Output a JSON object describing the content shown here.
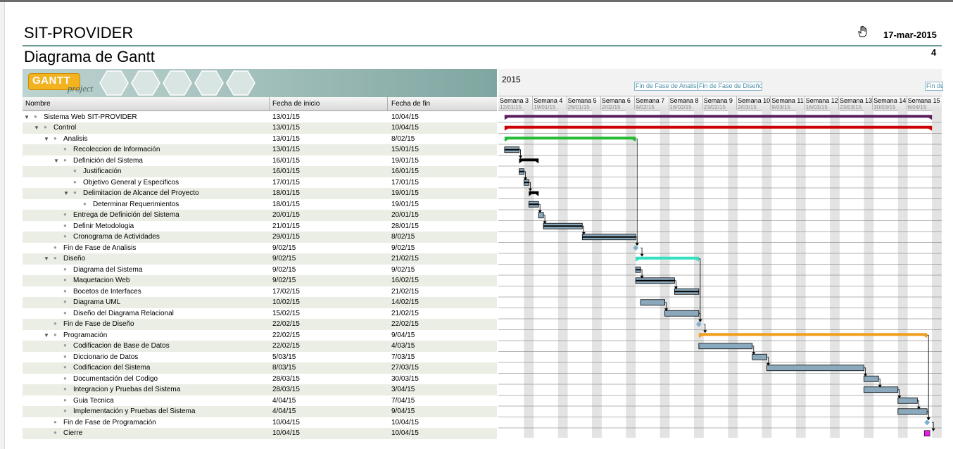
{
  "header": {
    "project_title": "SIT-PROVIDER",
    "document_title": "Diagrama de Gantt",
    "date": "17-mar-2015",
    "page_number": "4"
  },
  "logo": {
    "main": "GANTT",
    "sub": "project"
  },
  "columns": {
    "name": "Nombre",
    "start": "Fecha de inicio",
    "end": "Fecha de fin"
  },
  "tasks": [
    {
      "name": "Sistema Web SIT-PROVIDER",
      "start": "13/01/15",
      "end": "10/04/15",
      "level": 0,
      "expanded": true
    },
    {
      "name": "Control",
      "start": "13/01/15",
      "end": "10/04/15",
      "level": 1,
      "expanded": true
    },
    {
      "name": "Analisis",
      "start": "13/01/15",
      "end": "8/02/15",
      "level": 2,
      "expanded": true
    },
    {
      "name": "Recoleccion de Información",
      "start": "13/01/15",
      "end": "15/01/15",
      "level": 3
    },
    {
      "name": "Definición del Sistema",
      "start": "16/01/15",
      "end": "19/01/15",
      "level": 3,
      "expanded": true
    },
    {
      "name": "Justificación",
      "start": "16/01/15",
      "end": "16/01/15",
      "level": 4
    },
    {
      "name": "Objetivo General y Especificos",
      "start": "17/01/15",
      "end": "17/01/15",
      "level": 4
    },
    {
      "name": "Delimitacion de Alcance del Proyecto",
      "start": "18/01/15",
      "end": "19/01/15",
      "level": 4,
      "expanded": true
    },
    {
      "name": "Determinar Requerimientos",
      "start": "18/01/15",
      "end": "19/01/15",
      "level": 5
    },
    {
      "name": "Entrega de Definición del Sistema",
      "start": "20/01/15",
      "end": "20/01/15",
      "level": 3
    },
    {
      "name": "Definir Metodologia",
      "start": "21/01/15",
      "end": "28/01/15",
      "level": 3
    },
    {
      "name": "Cronograma de Actividades",
      "start": "29/01/15",
      "end": "8/02/15",
      "level": 3
    },
    {
      "name": "Fin de Fase de Analisis",
      "start": "9/02/15",
      "end": "9/02/15",
      "level": 2
    },
    {
      "name": "Diseño",
      "start": "9/02/15",
      "end": "21/02/15",
      "level": 2,
      "expanded": true
    },
    {
      "name": "Diagrama del Sistema",
      "start": "9/02/15",
      "end": "9/02/15",
      "level": 3
    },
    {
      "name": "Maquetacion Web",
      "start": "9/02/15",
      "end": "16/02/15",
      "level": 3
    },
    {
      "name": "Bocetos de Interfaces",
      "start": "17/02/15",
      "end": "21/02/15",
      "level": 3
    },
    {
      "name": "Diagrama UML",
      "start": "10/02/15",
      "end": "14/02/15",
      "level": 3
    },
    {
      "name": "Diseño del Diagrama Relacional",
      "start": "15/02/15",
      "end": "21/02/15",
      "level": 3
    },
    {
      "name": "Fin de Fase de Diseño",
      "start": "22/02/15",
      "end": "22/02/15",
      "level": 2
    },
    {
      "name": "Programación",
      "start": "22/02/15",
      "end": "9/04/15",
      "level": 2,
      "expanded": true
    },
    {
      "name": "Codificacion de Base de Datos",
      "start": "22/02/15",
      "end": "4/03/15",
      "level": 3
    },
    {
      "name": "Diccionario de Datos",
      "start": "5/03/15",
      "end": "7/03/15",
      "level": 3
    },
    {
      "name": "Codificacion del Sistema",
      "start": "8/03/15",
      "end": "27/03/15",
      "level": 3
    },
    {
      "name": "Documentación del Codigo",
      "start": "28/03/15",
      "end": "30/03/15",
      "level": 3
    },
    {
      "name": "Integracion y Pruebas del Sistema",
      "start": "28/03/15",
      "end": "3/04/15",
      "level": 3
    },
    {
      "name": "Guia Tecnica",
      "start": "4/04/15",
      "end": "7/04/15",
      "level": 3
    },
    {
      "name": "Implementación y Pruebas del Sistema",
      "start": "4/04/15",
      "end": "9/04/15",
      "level": 3
    },
    {
      "name": "Fin de Fase de Programación",
      "start": "10/04/15",
      "end": "10/04/15",
      "level": 2
    },
    {
      "name": "Cierre",
      "start": "10/04/15",
      "end": "10/04/15",
      "level": 2
    }
  ],
  "gantt": {
    "year": "2015",
    "milestone_labels": [
      "Fin de Fase de Analisis",
      "Fin de Fase de Diseño",
      "Fin de"
    ],
    "weeks": [
      {
        "label": "Semana 3",
        "date": "12/01/15"
      },
      {
        "label": "Semana 4",
        "date": "19/01/15"
      },
      {
        "label": "Semana 5",
        "date": "26/01/15"
      },
      {
        "label": "Semana 6",
        "date": "2/02/15"
      },
      {
        "label": "Semana 7",
        "date": "9/02/15"
      },
      {
        "label": "Semana 8",
        "date": "16/02/15"
      },
      {
        "label": "Semana 9",
        "date": "23/02/15"
      },
      {
        "label": "Semana 10",
        "date": "2/03/15"
      },
      {
        "label": "Semana 11",
        "date": "9/03/15"
      },
      {
        "label": "Semana 12",
        "date": "16/03/15"
      },
      {
        "label": "Semana 13",
        "date": "23/03/15"
      },
      {
        "label": "Semana 14",
        "date": "30/03/15"
      },
      {
        "label": "Semana 15",
        "date": "6/04/15"
      }
    ],
    "colors": {
      "summary_root": "#5a1f5e",
      "summary_control": "#cc0000",
      "summary_analisis": "#22bb33",
      "summary_diseno": "#33e0c0",
      "summary_programacion": "#f0a020",
      "task_bar": "#8aa9bd",
      "milestone": "#7bb0cf",
      "closure": "#e020e0",
      "weekend": "#e3e3e3"
    }
  }
}
